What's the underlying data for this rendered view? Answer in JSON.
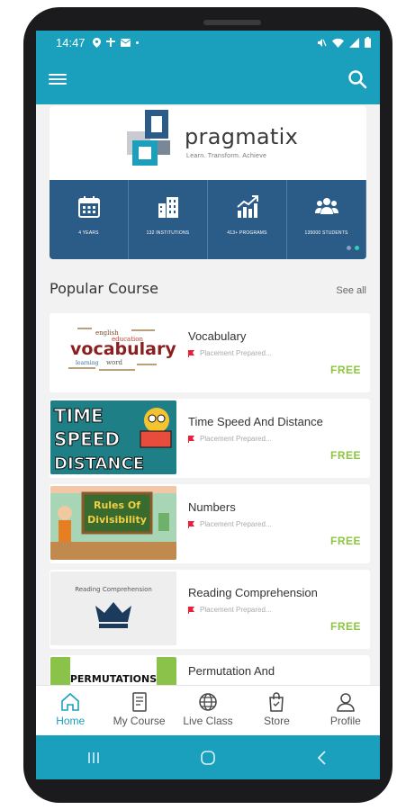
{
  "status_bar": {
    "time": "14:47"
  },
  "brand": {
    "name": "pragmatix",
    "tagline": "Learn.  Transform.  Achieve"
  },
  "stats": [
    {
      "icon": "calendar-icon",
      "label": "4 YEARS"
    },
    {
      "icon": "buildings-icon",
      "label": "132 INSTITUTIONS"
    },
    {
      "icon": "growth-chart-icon",
      "label": "413+ PROGRAMS"
    },
    {
      "icon": "group-icon",
      "label": "135000 STUDENTS"
    }
  ],
  "section": {
    "title": "Popular Course",
    "see_all": "See all"
  },
  "courses": [
    {
      "name": "Vocabulary",
      "category": "Placement Prepared...",
      "price": "FREE",
      "thumb": {
        "main": "vocabulary",
        "small": [
          "english",
          "education",
          "word",
          "learning"
        ]
      }
    },
    {
      "name": "Time Speed And Distance",
      "category": "Placement Prepared...",
      "price": "FREE",
      "thumb": {
        "lines": [
          "TIME",
          "SPEED",
          "DISTANCE"
        ]
      }
    },
    {
      "name": "Numbers",
      "category": "Placement Prepared...",
      "price": "FREE",
      "thumb": {
        "board": [
          "Rules Of",
          "Divisibility"
        ]
      }
    },
    {
      "name": "Reading Comprehension",
      "category": "Placement Prepared...",
      "price": "FREE",
      "thumb": {
        "caption": "Reading Comprehension"
      }
    },
    {
      "name": "Permutation And",
      "category": "",
      "price": "",
      "thumb": {
        "caption": "PERMUTATIONS"
      }
    }
  ],
  "bottom_nav": [
    {
      "label": "Home",
      "icon": "home-icon",
      "active": true
    },
    {
      "label": "My Course",
      "icon": "book-icon",
      "active": false
    },
    {
      "label": "Live Class",
      "icon": "globe-icon",
      "active": false
    },
    {
      "label": "Store",
      "icon": "shopping-bag-icon",
      "active": false
    },
    {
      "label": "Profile",
      "icon": "user-icon",
      "active": false
    }
  ],
  "colors": {
    "primary": "#1a9fbd",
    "stats_bg": "#2b5c88",
    "free": "#8cc63f",
    "flag": "#e8203c"
  }
}
